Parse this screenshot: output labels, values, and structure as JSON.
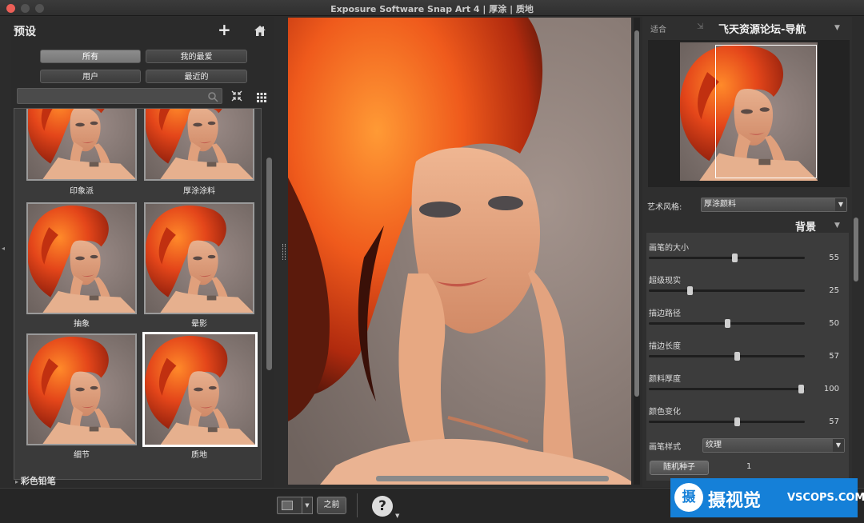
{
  "window": {
    "title": "Exposure Software Snap Art 4 | 厚涂 | 质地"
  },
  "presets": {
    "heading": "预设",
    "add_icon": "plus-icon",
    "home_icon": "home-icon",
    "filters": [
      "所有",
      "我的最爱",
      "用户",
      "最近的"
    ],
    "selected_filter": "所有",
    "search_placeholder": "",
    "tiles": [
      "印象派",
      "厚涂涂料",
      "抽象",
      "晕影",
      "细节",
      "质地"
    ],
    "active_tile": "质地",
    "next_category": "彩色铅笔"
  },
  "navigator": {
    "fit_label": "适合",
    "title": "飞天资源论坛-导航"
  },
  "style": {
    "label": "艺术风格:",
    "value": "厚涂颜料"
  },
  "section": {
    "title": "背景"
  },
  "sliders": [
    {
      "label": "画笔的大小",
      "value": 55,
      "fraction": 0.55
    },
    {
      "label": "超级现实",
      "value": 25,
      "fraction": 0.25
    },
    {
      "label": "描边路径",
      "value": 50,
      "fraction": 0.5
    },
    {
      "label": "描边长度",
      "value": 57,
      "fraction": 0.57
    },
    {
      "label": "颜料厚度",
      "value": 100,
      "fraction": 1.0
    },
    {
      "label": "颜色变化",
      "value": 57,
      "fraction": 0.57
    }
  ],
  "brush_style": {
    "label": "画笔样式",
    "value": "纹理"
  },
  "random_seed": {
    "button": "随机种子",
    "value": "1"
  },
  "bottom": {
    "before_label": "之前",
    "help": "?"
  },
  "watermark": {
    "brand": "摄视觉",
    "site": "VSCOPS.COM",
    "logo_char": "摄"
  },
  "colors": {
    "accent": "#1580d8",
    "hair": "#e8471a",
    "background": "#2c2c2c"
  }
}
